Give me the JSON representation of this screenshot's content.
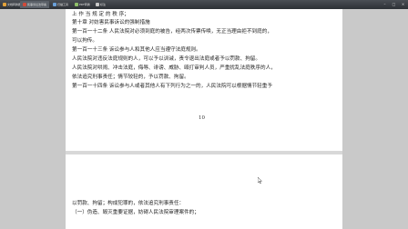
{
  "window": {
    "tabs": [
      {
        "label": "文档转换器",
        "active": false
      },
      {
        "label": "民事诉讼法草案",
        "active": true
      },
      {
        "label": "扫描工具",
        "active": false
      },
      {
        "label": "PDF转换",
        "active": false
      },
      {
        "label": "标注",
        "active": false
      }
    ],
    "controls": {
      "minimize": "–",
      "maximize": "□",
      "close": "×"
    }
  },
  "page1": {
    "lines": [
      "上 作 当 规 定 的 秩 序；",
      "第十章    对妨害民事诉讼的强制措施",
      "第一百一十二条    人民法院对必须到庭的被告，经两次传票传唤，无正当理由拒不到庭的，",
      "可以拘传。",
      "第一百一十三条    诉讼参与人和其他人应当遵守法庭规则。",
      "人民法院对违反法庭规则的人，可以予以训诫，责令退出法庭或者予以罚款、拘留。",
      "人民法院对哄闹、冲击法庭，侮辱、诽谤、威胁、殴打审判人员，严重扰乱法庭秩序的人，",
      "依法追究刑事责任；情节较轻的，予以罚款、拘留。",
      "第一百一十四条    诉讼参与人或者其他人有下列行为之一的，人民法院可以根据情节轻重予"
    ],
    "page_number": "10"
  },
  "page2": {
    "lines": [
      "以罚款、拘留；构成犯罪的，依法追究刑事责任：",
      "（一）伪造、毁灭重要证据，妨碍人民法院审理案件的；"
    ]
  }
}
